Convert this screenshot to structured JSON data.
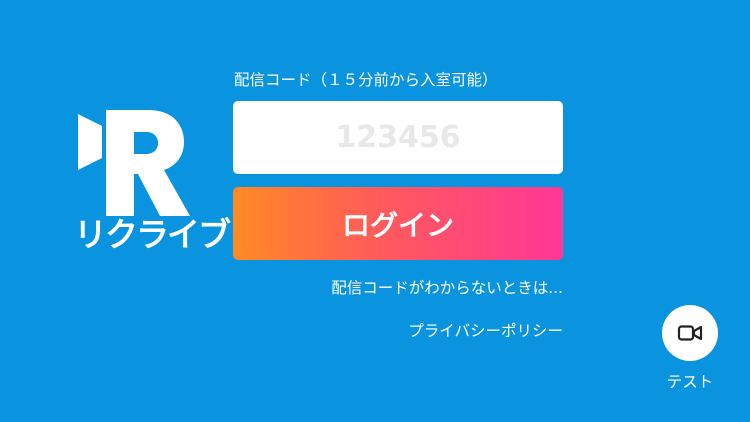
{
  "brand": {
    "logo_text": "リクライブ",
    "logo_icon": "r-camera-logo-icon",
    "background_color": "#0a93df"
  },
  "login_form": {
    "code_label": "配信コード（１５分前から入室可能）",
    "code_placeholder": "123456",
    "code_value": "",
    "login_label": "ログイン",
    "login_gradient": [
      "#ff8a24",
      "#ff3796"
    ]
  },
  "links": {
    "help": "配信コードがわからないときは...",
    "privacy": "プライバシーポリシー"
  },
  "test": {
    "icon": "video-camera-icon",
    "label": "テスト"
  }
}
